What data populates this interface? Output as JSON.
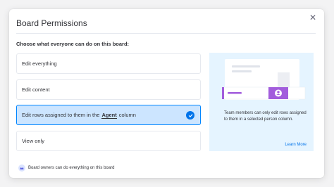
{
  "modal": {
    "title": "Board Permissions",
    "close_icon": "close-icon",
    "subtitle": "Choose what everyone can do on this board:"
  },
  "options": [
    {
      "label": "Edit everything",
      "selected": false
    },
    {
      "label": "Edit content",
      "selected": false
    },
    {
      "label_before": "Edit rows assigned to them in the",
      "label_column": "Agent",
      "label_after": "column",
      "selected": true
    },
    {
      "label": "View only",
      "selected": false
    }
  ],
  "info_panel": {
    "description": "Team members can only edit rows assigned to them in a selected person column.",
    "learn_more": "Learn More"
  },
  "footer": {
    "text": "Board owners can do everything on this board",
    "icon": "crown-badge-icon"
  },
  "colors": {
    "accent": "#0073ea",
    "selected_bg": "#cce5ff",
    "selected_border": "#0085ff",
    "info_bg": "#e5f4ff",
    "illustration_purple": "#a25ddc"
  }
}
